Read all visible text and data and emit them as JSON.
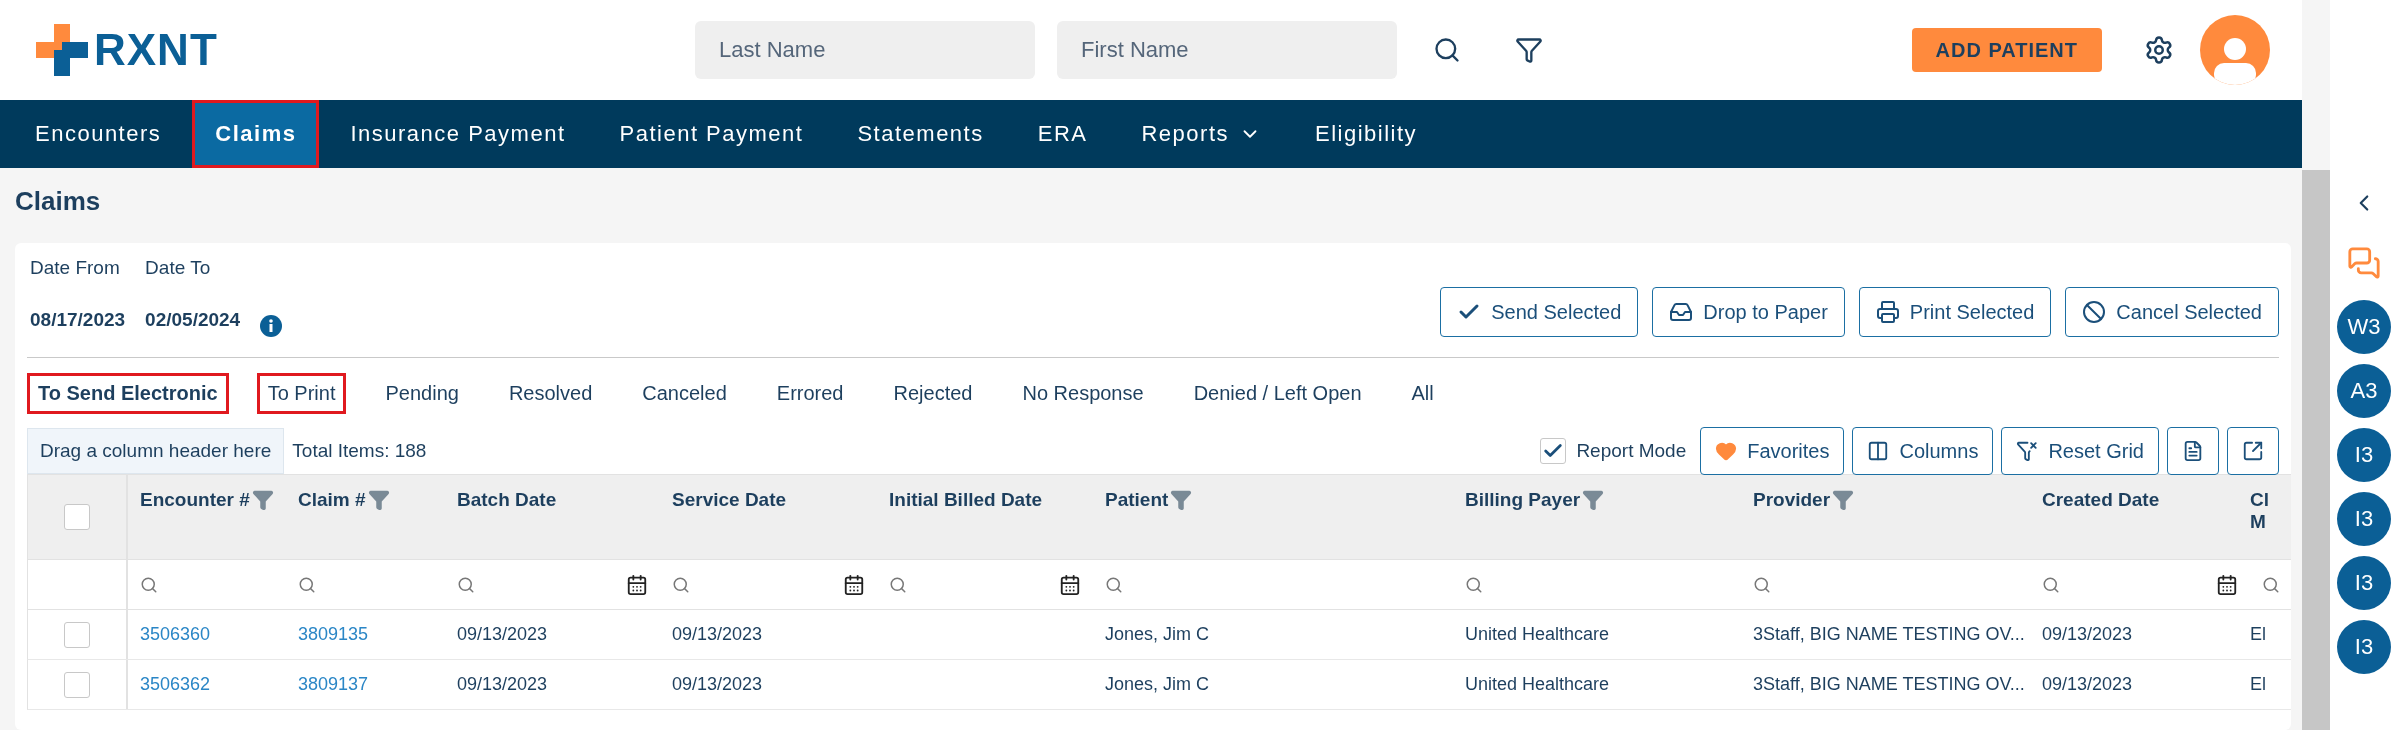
{
  "header": {
    "logo_text": "RXNT",
    "search_fields": [
      {
        "placeholder": "Last Name"
      },
      {
        "placeholder": "First Name"
      }
    ],
    "add_button": "ADD PATIENT"
  },
  "nav": [
    {
      "label": "Encounters",
      "selected": false,
      "annotated": false,
      "dropdown": false
    },
    {
      "label": "Claims",
      "selected": true,
      "annotated": true,
      "dropdown": false
    },
    {
      "label": "Insurance Payment",
      "selected": false,
      "annotated": false,
      "dropdown": false
    },
    {
      "label": "Patient Payment",
      "selected": false,
      "annotated": false,
      "dropdown": false
    },
    {
      "label": "Statements",
      "selected": false,
      "annotated": false,
      "dropdown": false
    },
    {
      "label": "ERA",
      "selected": false,
      "annotated": false,
      "dropdown": false
    },
    {
      "label": "Reports",
      "selected": false,
      "annotated": false,
      "dropdown": true
    },
    {
      "label": "Eligibility",
      "selected": false,
      "annotated": false,
      "dropdown": false
    }
  ],
  "page_title": "Claims",
  "dates": {
    "from_label": "Date From",
    "to_label": "Date To",
    "from": "08/17/2023",
    "to": "02/05/2024"
  },
  "actions": [
    {
      "kind": "check",
      "label": "Send Selected"
    },
    {
      "kind": "inbox",
      "label": "Drop to Paper"
    },
    {
      "kind": "print",
      "label": "Print Selected"
    },
    {
      "kind": "cancel",
      "label": "Cancel Selected"
    }
  ],
  "status_tabs": [
    {
      "label": "To Send Electronic",
      "selected": true,
      "annotated": true
    },
    {
      "label": "To Print",
      "selected": false,
      "annotated": true
    },
    {
      "label": "Pending",
      "selected": false,
      "annotated": false
    },
    {
      "label": "Resolved",
      "selected": false,
      "annotated": false
    },
    {
      "label": "Canceled",
      "selected": false,
      "annotated": false
    },
    {
      "label": "Errored",
      "selected": false,
      "annotated": false
    },
    {
      "label": "Rejected",
      "selected": false,
      "annotated": false
    },
    {
      "label": "No Response",
      "selected": false,
      "annotated": false
    },
    {
      "label": "Denied / Left Open",
      "selected": false,
      "annotated": false
    },
    {
      "label": "All",
      "selected": false,
      "annotated": false
    }
  ],
  "group_hint": "Drag a column header here",
  "total_items": "Total Items: 188",
  "report_mode": {
    "label": "Report Mode",
    "checked": true
  },
  "grid_tools": [
    {
      "kind": "favorites",
      "label": "Favorites"
    },
    {
      "kind": "columns",
      "label": "Columns"
    },
    {
      "kind": "reset",
      "label": "Reset Grid"
    },
    {
      "kind": "pdf"
    },
    {
      "kind": "export"
    }
  ],
  "table": {
    "select_all_checked": false,
    "columns": [
      {
        "label": "Encounter #",
        "kind": "text",
        "filter": true
      },
      {
        "label": "Claim #",
        "kind": "text",
        "filter": true
      },
      {
        "label": "Batch Date",
        "kind": "date",
        "filter": false
      },
      {
        "label": "Service Date",
        "kind": "date",
        "filter": false
      },
      {
        "label": "Initial Billed Date",
        "kind": "date",
        "filter": false
      },
      {
        "label": "Patient",
        "kind": "text",
        "filter": true
      },
      {
        "label": "Billing Payer",
        "kind": "text",
        "filter": true
      },
      {
        "label": "Provider",
        "kind": "text",
        "filter": true
      },
      {
        "label": "Created Date",
        "kind": "date",
        "filter": false
      },
      {
        "label": "Cl M",
        "kind": "text"
      }
    ],
    "rows": [
      {
        "checked": false,
        "cells": [
          "3506360",
          "3809135",
          "09/13/2023",
          "09/13/2023",
          "",
          "Jones, Jim C",
          "United Healthcare",
          "3Staff, BIG NAME TESTING OV...",
          "09/13/2023",
          "El"
        ]
      },
      {
        "checked": false,
        "cells": [
          "3506362",
          "3809137",
          "09/13/2023",
          "09/13/2023",
          "",
          "Jones, Jim C",
          "United Healthcare",
          "3Staff, BIG NAME TESTING OV...",
          "09/13/2023",
          "El"
        ]
      }
    ]
  },
  "side_panel": {
    "badges": [
      "W3",
      "A3",
      "I3",
      "I3",
      "I3",
      "I3"
    ]
  }
}
